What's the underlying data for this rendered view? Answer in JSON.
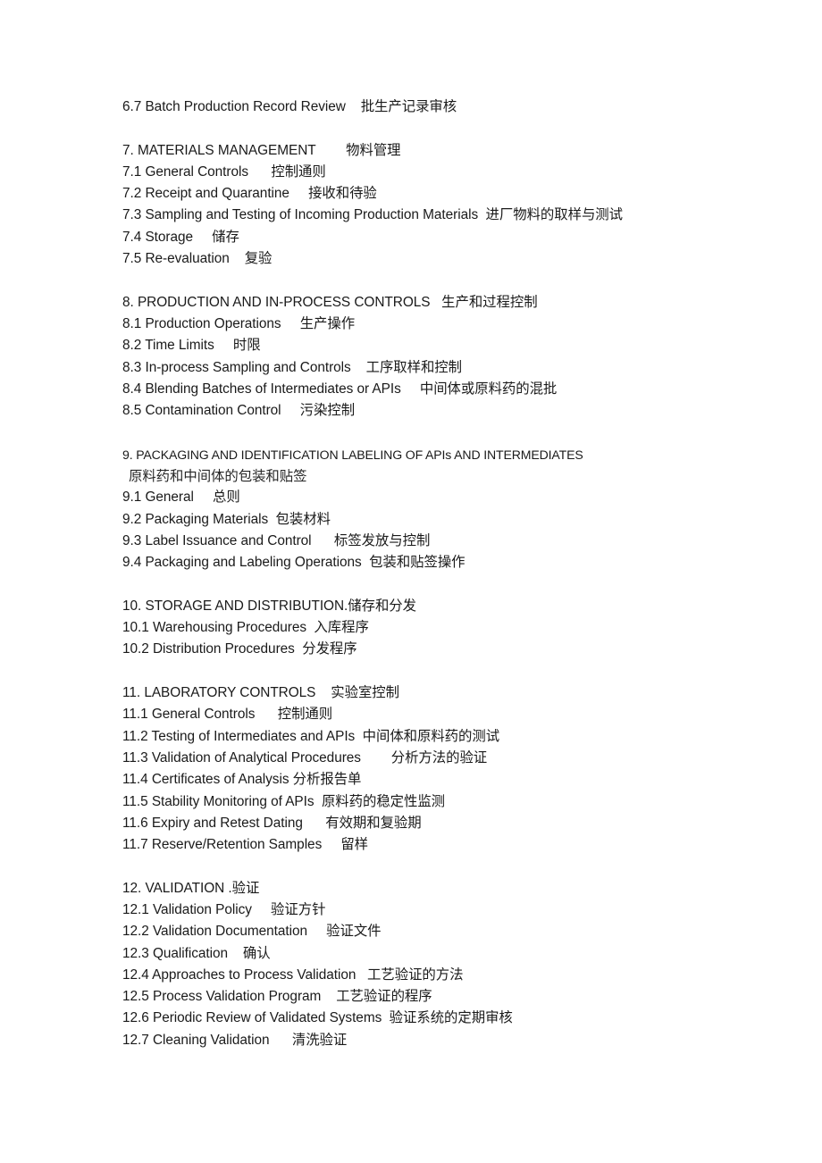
{
  "document": {
    "type": "table-of-contents",
    "language": "en-zh",
    "background_color": "#ffffff",
    "text_color": "#1a1a1a",
    "blocks": [
      {
        "id": "section-6-tail",
        "lines": [
          {
            "id": "6-7",
            "text": "6.7 Batch Production Record Review    批生产记录审核",
            "style": "entry"
          }
        ]
      },
      {
        "id": "section-7",
        "lines": [
          {
            "id": "7",
            "text": "7. MATERIALS MANAGEMENT        物料管理",
            "style": "heading"
          },
          {
            "id": "7-1",
            "text": "7.1 General Controls      控制通则",
            "style": "entry"
          },
          {
            "id": "7-2",
            "text": "7.2 Receipt and Quarantine     接收和待验",
            "style": "entry"
          },
          {
            "id": "7-3",
            "text": "7.3 Sampling and Testing of Incoming Production Materials  进厂物料的取样与测试",
            "style": "entry"
          },
          {
            "id": "7-4",
            "text": "7.4 Storage     储存",
            "style": "entry"
          },
          {
            "id": "7-5",
            "text": "7.5 Re-evaluation    复验",
            "style": "entry"
          }
        ]
      },
      {
        "id": "section-8",
        "lines": [
          {
            "id": "8",
            "text": "8. PRODUCTION AND IN-PROCESS CONTROLS   生产和过程控制",
            "style": "heading"
          },
          {
            "id": "8-1",
            "text": "8.1 Production Operations     生产操作",
            "style": "entry"
          },
          {
            "id": "8-2",
            "text": "8.2 Time Limits     时限",
            "style": "entry"
          },
          {
            "id": "8-3",
            "text": "8.3 In-process Sampling and Controls    工序取样和控制",
            "style": "entry"
          },
          {
            "id": "8-4",
            "text": "8.4 Blending Batches of Intermediates or APIs     中间体或原料药的混批",
            "style": "entry"
          },
          {
            "id": "8-5",
            "text": "8.5 Contamination Control     污染控制",
            "style": "entry"
          }
        ]
      },
      {
        "id": "section-9",
        "lines": [
          {
            "id": "9",
            "text": "9. PACKAGING AND IDENTIFICATION LABELING OF APIs AND INTERMEDIATES",
            "style": "heading-narrow"
          },
          {
            "id": "9-zh",
            "text": "原料药和中间体的包装和贴签",
            "style": "continuation"
          },
          {
            "id": "9-1",
            "text": "9.1 General     总则",
            "style": "entry"
          },
          {
            "id": "9-2",
            "text": "9.2 Packaging Materials  包装材料",
            "style": "entry"
          },
          {
            "id": "9-3",
            "text": "9.3 Label Issuance and Control      标签发放与控制",
            "style": "entry"
          },
          {
            "id": "9-4",
            "text": "9.4 Packaging and Labeling Operations  包装和贴签操作",
            "style": "entry"
          }
        ]
      },
      {
        "id": "section-10",
        "lines": [
          {
            "id": "10",
            "text": "10. STORAGE AND DISTRIBUTION.储存和分发",
            "style": "heading"
          },
          {
            "id": "10-1",
            "text": "10.1 Warehousing Procedures  入库程序",
            "style": "entry"
          },
          {
            "id": "10-2",
            "text": "10.2 Distribution Procedures  分发程序",
            "style": "entry"
          }
        ]
      },
      {
        "id": "section-11",
        "lines": [
          {
            "id": "11",
            "text": "11. LABORATORY CONTROLS    实验室控制",
            "style": "heading"
          },
          {
            "id": "11-1",
            "text": "11.1 General Controls      控制通则",
            "style": "entry"
          },
          {
            "id": "11-2",
            "text": "11.2 Testing of Intermediates and APIs  中间体和原料药的测试",
            "style": "entry"
          },
          {
            "id": "11-3",
            "text": "11.3 Validation of Analytical Procedures        分析方法的验证",
            "style": "entry"
          },
          {
            "id": "11-4",
            "text": "11.4 Certificates of Analysis 分析报告单",
            "style": "entry"
          },
          {
            "id": "11-5",
            "text": "11.5 Stability Monitoring of APIs  原料药的稳定性监测",
            "style": "entry"
          },
          {
            "id": "11-6",
            "text": "11.6 Expiry and Retest Dating      有效期和复验期",
            "style": "entry"
          },
          {
            "id": "11-7",
            "text": "11.7 Reserve/Retention Samples     留样",
            "style": "entry"
          }
        ]
      },
      {
        "id": "section-12",
        "lines": [
          {
            "id": "12",
            "text": "12. VALIDATION .验证",
            "style": "heading"
          },
          {
            "id": "12-1",
            "text": "12.1 Validation Policy     验证方针",
            "style": "entry"
          },
          {
            "id": "12-2",
            "text": "12.2 Validation Documentation     验证文件",
            "style": "entry"
          },
          {
            "id": "12-3",
            "text": "12.3 Qualification    确认",
            "style": "entry"
          },
          {
            "id": "12-4",
            "text": "12.4 Approaches to Process Validation   工艺验证的方法",
            "style": "entry"
          },
          {
            "id": "12-5",
            "text": "12.5 Process Validation Program    工艺验证的程序",
            "style": "entry"
          },
          {
            "id": "12-6",
            "text": "12.6 Periodic Review of Validated Systems  验证系统的定期审核",
            "style": "entry"
          },
          {
            "id": "12-7",
            "text": "12.7 Cleaning Validation      清洗验证",
            "style": "entry"
          }
        ]
      }
    ]
  }
}
